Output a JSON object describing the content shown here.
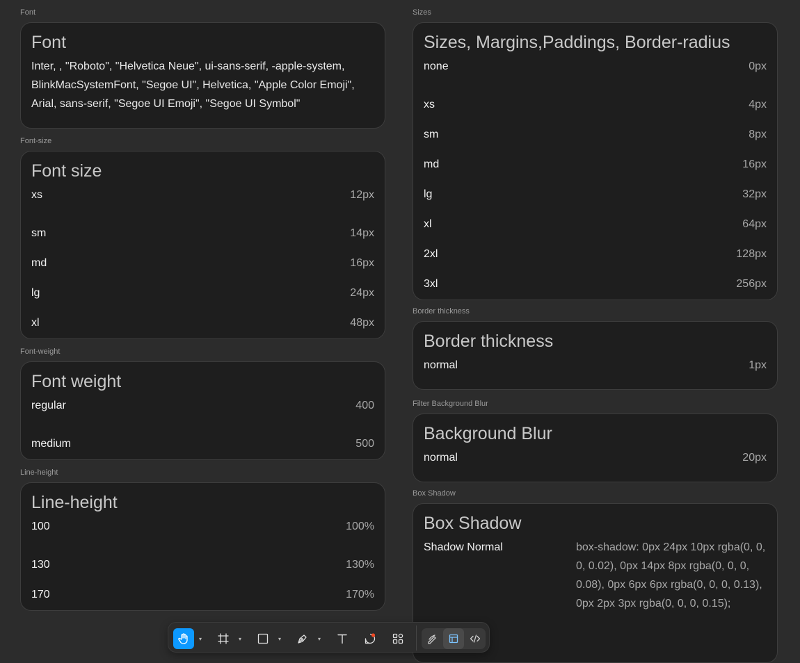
{
  "sections": {
    "font": {
      "frame_label": "Font",
      "title": "Font",
      "value": "Inter, , \"Roboto\", \"Helvetica Neue\", ui-sans-serif, -apple-system, BlinkMacSystemFont, \"Segoe UI\", Helvetica, \"Apple Color Emoji\", Arial, sans-serif, \"Segoe UI Emoji\", \"Segoe UI Symbol\""
    },
    "font_size": {
      "frame_label": "Font-size",
      "title": "Font size",
      "rows": [
        {
          "key": "xs",
          "value": "12px"
        },
        {
          "key": "sm",
          "value": "14px"
        },
        {
          "key": "md",
          "value": "16px"
        },
        {
          "key": "lg",
          "value": "24px"
        },
        {
          "key": "xl",
          "value": "48px"
        }
      ]
    },
    "font_weight": {
      "frame_label": "Font-weight",
      "title": "Font weight",
      "rows": [
        {
          "key": "regular",
          "value": "400"
        },
        {
          "key": "medium",
          "value": "500"
        }
      ]
    },
    "line_height": {
      "frame_label": "Line-height",
      "title": "Line-height",
      "rows": [
        {
          "key": "100",
          "value": "100%"
        },
        {
          "key": "130",
          "value": "130%"
        },
        {
          "key": "170",
          "value": "170%"
        }
      ]
    },
    "sizes": {
      "frame_label": "Sizes",
      "title": "Sizes, Margins,Paddings, Border-radius",
      "rows": [
        {
          "key": "none",
          "value": "0px"
        },
        {
          "key": "xs",
          "value": "4px"
        },
        {
          "key": "sm",
          "value": "8px"
        },
        {
          "key": "md",
          "value": "16px"
        },
        {
          "key": "lg",
          "value": "32px"
        },
        {
          "key": "xl",
          "value": "64px"
        },
        {
          "key": "2xl",
          "value": "128px"
        },
        {
          "key": "3xl",
          "value": "256px"
        }
      ]
    },
    "border": {
      "frame_label": "Border thickness",
      "title": "Border thickness",
      "rows": [
        {
          "key": "normal",
          "value": "1px"
        }
      ]
    },
    "blur": {
      "frame_label": "Filter Background Blur",
      "title": "Background Blur",
      "rows": [
        {
          "key": "normal",
          "value": "20px"
        }
      ]
    },
    "shadow": {
      "frame_label": "Box Shadow",
      "title": "Box Shadow",
      "key": "Shadow Normal",
      "value": "box-shadow: 0px 24px 10px rgba(0, 0, 0, 0.02), 0px 14px 8px rgba(0, 0, 0, 0.08), 0px 6px 6px rgba(0, 0, 0, 0.13), 0px 2px 3px rgba(0, 0, 0, 0.15);"
    }
  },
  "toolbar": {
    "tools": [
      {
        "icon": "hand-icon",
        "active": true
      },
      {
        "icon": "frame-icon",
        "active": false
      },
      {
        "icon": "rectangle-icon",
        "active": false
      },
      {
        "icon": "pen-icon",
        "active": false
      },
      {
        "icon": "text-icon",
        "active": false
      },
      {
        "icon": "comment-icon",
        "active": false
      },
      {
        "icon": "components-icon",
        "active": false
      }
    ],
    "modes": [
      {
        "icon": "draw-mode-icon"
      },
      {
        "icon": "design-mode-icon",
        "selected": true
      },
      {
        "icon": "dev-mode-icon"
      }
    ],
    "colors": {
      "accent": "#0d99ff",
      "notification_dot": "#f24822"
    }
  }
}
